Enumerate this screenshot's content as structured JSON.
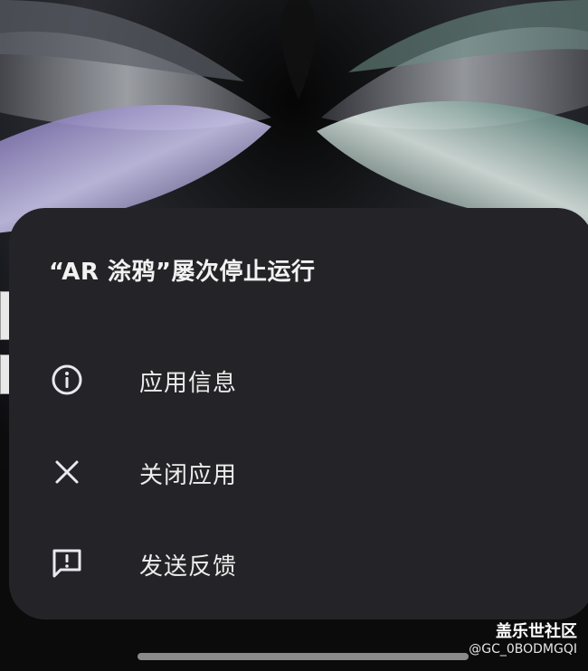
{
  "dialog": {
    "title": "“AR 涂鸦”屡次停止运行",
    "items": [
      {
        "label": "应用信息",
        "icon": "info-icon"
      },
      {
        "label": "关闭应用",
        "icon": "close-icon"
      },
      {
        "label": "发送反馈",
        "icon": "feedback-icon"
      }
    ]
  },
  "watermark": {
    "title": "盖乐世社区",
    "id": "@GC_0BODMGQI"
  },
  "colors": {
    "dialog_background": "#242428",
    "text": "#ececec",
    "icon": "#e8e8f0"
  }
}
